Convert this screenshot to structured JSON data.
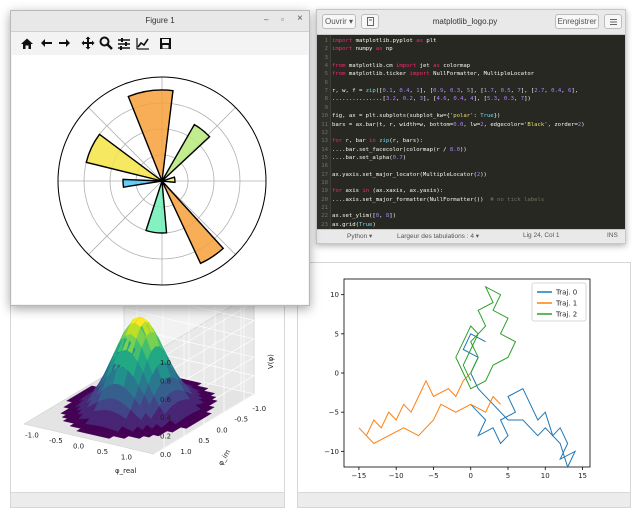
{
  "figure_window": {
    "title": "Figure 1",
    "controls": {
      "minimize": "–",
      "maximize": "▫",
      "close": "×"
    },
    "toolbar": [
      {
        "name": "home-icon"
      },
      {
        "name": "back-arrow-icon"
      },
      {
        "name": "forward-arrow-icon"
      },
      {
        "name": "pan-icon"
      },
      {
        "name": "zoom-icon"
      },
      {
        "name": "subplots-icon"
      },
      {
        "name": "edit-curves-icon"
      },
      {
        "name": "save-icon"
      }
    ]
  },
  "editor": {
    "open_label": "Ouvrir ▾",
    "title": "matplotlib_logo.py",
    "save_label": "Enregistrer",
    "menu_icon": "hamburger-icon",
    "code_lines": [
      "import matplotlib.pyplot as plt",
      "import numpy as np",
      "",
      "from matplotlib.cm import jet as colormap",
      "from matplotlib.ticker import NullFormatter, MultipleLocator",
      "",
      "r, w, f = zip([0.1, 0.4, 1], [0.9, 0.3, 5], [1.7, 0.5, 7], [2.7, 0.4, 6],",
      "...............[3.2, 0.2, 3], [4.6, 0.4, 4], [5.3, 0.3, 7])",
      "",
      "fig, ax = plt.subplots(subplot_kw={'polar': True})",
      "bars = ax.bar(t, r, width=w, bottom=0.0, lw=2, edgecolor='Black', zorder=2)",
      "",
      "for r, bar in zip(r, bars):",
      "....bar.set_facecolor(colormap(r / 8.0))",
      "....bar.set_alpha(0.7)",
      "",
      "ax.yaxis.set_major_locator(MultipleLocator(2))",
      "",
      "for axis in (ax.xaxis, ax.yaxis):",
      "....axis.set_major_formatter(NullFormatter())  # no tick labels",
      "",
      "ax.set_ylim([0, 8])",
      "ax.grid(True)",
      "",
      "plt.show()"
    ],
    "status": {
      "language": "Python ▾",
      "tab_width": "Largeur des tabulations : 4 ▾",
      "position": "Lig 24, Col 1",
      "mode": "INS"
    }
  },
  "chart_data": [
    {
      "type": "bar",
      "polar": true,
      "title": "",
      "grid": true,
      "ylim": [
        0,
        8
      ],
      "radial_gridlines": [
        2,
        4,
        6,
        8
      ],
      "bars": [
        {
          "theta": 0.1,
          "width": 0.4,
          "radius": 1,
          "color": "#e8f07a"
        },
        {
          "theta": 0.9,
          "width": 0.3,
          "radius": 5,
          "color": "#b6ea7a"
        },
        {
          "theta": 1.7,
          "width": 0.5,
          "radius": 7,
          "color": "#f6a03a"
        },
        {
          "theta": 2.7,
          "width": 0.4,
          "radius": 6,
          "color": "#f4e445"
        },
        {
          "theta": 3.2,
          "width": 0.2,
          "radius": 3,
          "color": "#4cc3f4"
        },
        {
          "theta": 4.6,
          "width": 0.4,
          "radius": 4,
          "color": "#6ff0b5"
        },
        {
          "theta": 5.3,
          "width": 0.3,
          "radius": 7,
          "color": "#f6a03a"
        }
      ]
    },
    {
      "type": "surface",
      "title": "",
      "xlabel": "φ_real",
      "ylabel": "φ_im",
      "zlabel": "V(φ)",
      "x_ticks": [
        "-1.0",
        "-0.5",
        "0.0",
        "0.5",
        "1.0"
      ],
      "y_ticks": [
        "-1.0",
        "-0.5",
        "0.0",
        "0.5",
        "1.0"
      ],
      "z_ticks": [
        "0.0",
        "0.2",
        "0.4",
        "0.6",
        "0.8",
        "1.0"
      ],
      "colormap": "viridis"
    },
    {
      "type": "line",
      "title": "",
      "xlim": [
        -17,
        16
      ],
      "ylim": [
        -12,
        12
      ],
      "x_ticks": [
        -15,
        -10,
        -5,
        0,
        5,
        10,
        15
      ],
      "y_ticks": [
        -10,
        -5,
        0,
        5,
        10
      ],
      "series": [
        {
          "name": "Traj. 0",
          "color": "#1f77b4",
          "points": [
            [
              0,
              -4
            ],
            [
              1,
              -5
            ],
            [
              2,
              -6
            ],
            [
              1,
              -8
            ],
            [
              3,
              -7
            ],
            [
              4,
              -9
            ],
            [
              5,
              -8
            ],
            [
              4,
              -6
            ],
            [
              6,
              -5
            ],
            [
              5,
              -3
            ],
            [
              7,
              -2
            ],
            [
              8,
              -4
            ],
            [
              9,
              -6
            ],
            [
              10,
              -5
            ],
            [
              11,
              -8
            ],
            [
              12,
              -7
            ],
            [
              13,
              -9
            ],
            [
              12,
              -11
            ],
            [
              14,
              -10
            ],
            [
              13,
              -12
            ],
            [
              12,
              -9
            ],
            [
              10,
              -7
            ],
            [
              9,
              -8
            ],
            [
              7,
              -6
            ],
            [
              5,
              -6
            ],
            [
              3,
              -4
            ],
            [
              1,
              -2
            ],
            [
              0,
              0
            ],
            [
              1,
              2
            ],
            [
              -1,
              3
            ],
            [
              0,
              5
            ],
            [
              2,
              4
            ]
          ]
        },
        {
          "name": "Traj. 1",
          "color": "#ff7f0e",
          "points": [
            [
              0,
              0
            ],
            [
              -1,
              -1
            ],
            [
              -2,
              -3
            ],
            [
              -3,
              -2
            ],
            [
              -5,
              -3
            ],
            [
              -6,
              -1
            ],
            [
              -7,
              -3
            ],
            [
              -8,
              -5
            ],
            [
              -9,
              -4
            ],
            [
              -10,
              -6
            ],
            [
              -11,
              -5
            ],
            [
              -12,
              -7
            ],
            [
              -13,
              -6
            ],
            [
              -14,
              -8
            ],
            [
              -15,
              -7
            ],
            [
              -13,
              -9
            ],
            [
              -11,
              -8
            ],
            [
              -9,
              -7
            ],
            [
              -7,
              -8
            ],
            [
              -5,
              -6
            ],
            [
              -4,
              -4
            ],
            [
              -2,
              -5
            ],
            [
              0,
              -4
            ],
            [
              2,
              -5
            ],
            [
              3,
              -3
            ],
            [
              4,
              -4
            ]
          ]
        },
        {
          "name": "Traj. 2",
          "color": "#2ca02c",
          "points": [
            [
              0,
              0
            ],
            [
              1,
              2
            ],
            [
              0,
              4
            ],
            [
              2,
              6
            ],
            [
              1,
              8
            ],
            [
              3,
              9
            ],
            [
              2,
              11
            ],
            [
              4,
              10
            ],
            [
              3,
              8
            ],
            [
              5,
              7
            ],
            [
              4,
              5
            ],
            [
              6,
              4
            ],
            [
              5,
              2
            ],
            [
              3,
              1
            ],
            [
              2,
              -1
            ],
            [
              0,
              -2
            ],
            [
              -1,
              0
            ],
            [
              -2,
              2
            ],
            [
              -1,
              4
            ],
            [
              0,
              6
            ],
            [
              1,
              5
            ],
            [
              0,
              3
            ],
            [
              -1,
              1
            ],
            [
              0,
              -1
            ]
          ]
        }
      ]
    }
  ]
}
